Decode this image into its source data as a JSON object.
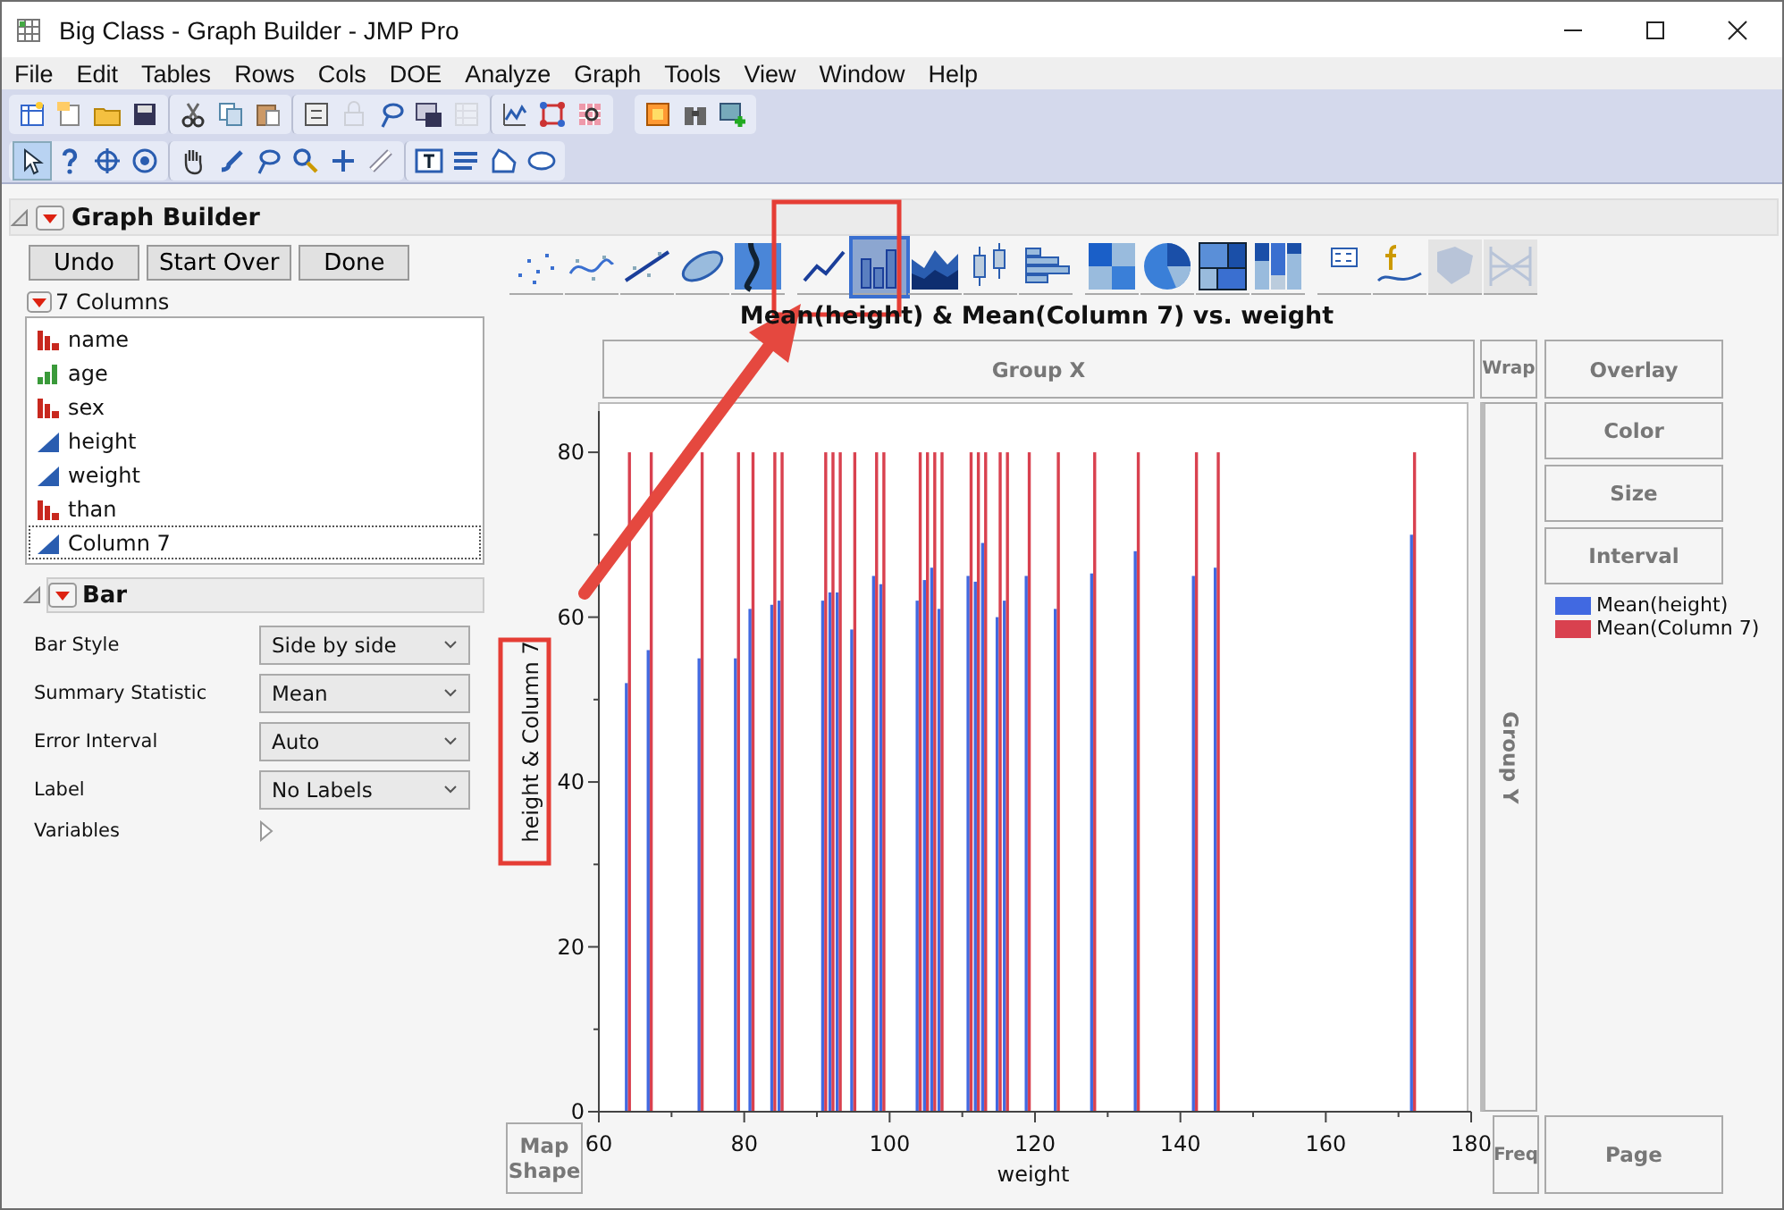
{
  "window": {
    "title": "Big Class - Graph Builder - JMP Pro"
  },
  "menu": [
    "File",
    "Edit",
    "Tables",
    "Rows",
    "Cols",
    "DOE",
    "Analyze",
    "Graph",
    "Tools",
    "View",
    "Window",
    "Help"
  ],
  "toolbars": [
    [
      [
        {
          "kind": "spreadsheet",
          "disabled": false
        },
        {
          "kind": "document",
          "disabled": false
        },
        {
          "kind": "folder",
          "disabled": false
        },
        {
          "kind": "floppy-disk",
          "disabled": false
        }
      ],
      [
        {
          "kind": "scissors",
          "disabled": false
        },
        {
          "kind": "copy",
          "disabled": false
        },
        {
          "kind": "clipboard",
          "disabled": false
        }
      ],
      [
        {
          "kind": "dialog-window",
          "disabled": false
        },
        {
          "kind": "lock",
          "disabled": true
        },
        {
          "kind": "lasso",
          "disabled": false
        },
        {
          "kind": "disk-window",
          "disabled": false
        },
        {
          "kind": "sheet",
          "disabled": true
        }
      ],
      [
        {
          "kind": "line-chart",
          "disabled": false
        },
        {
          "kind": "network",
          "disabled": false
        },
        {
          "kind": "grid-chart",
          "disabled": false
        }
      ],
      [
        {
          "kind": "board",
          "disabled": false
        },
        {
          "kind": "binoculars",
          "disabled": false
        },
        {
          "kind": "plus-window",
          "disabled": false
        }
      ]
    ],
    [
      [
        {
          "kind": "pointer",
          "selected": true
        },
        {
          "kind": "question-mark",
          "selected": false
        },
        {
          "kind": "crosshair",
          "selected": false
        },
        {
          "kind": "target",
          "selected": false
        }
      ],
      [
        {
          "kind": "hand",
          "selected": false
        },
        {
          "kind": "brush",
          "selected": false
        },
        {
          "kind": "lasso",
          "selected": false
        },
        {
          "kind": "magnifier",
          "selected": false
        },
        {
          "kind": "plus",
          "selected": false
        },
        {
          "kind": "ruler",
          "selected": false
        }
      ],
      [
        {
          "kind": "text-box",
          "selected": false
        },
        {
          "kind": "list-lines",
          "selected": false
        },
        {
          "kind": "freeform-shape",
          "selected": false
        },
        {
          "kind": "ellipse",
          "selected": false
        }
      ]
    ]
  ],
  "graph_builder": {
    "title": "Graph Builder",
    "buttons": [
      "Undo",
      "Start Over",
      "Done"
    ],
    "columns_header": "7 Columns",
    "columns": [
      {
        "name": "name",
        "kind": "nominal",
        "selected": false
      },
      {
        "name": "age",
        "kind": "ordinal",
        "selected": false
      },
      {
        "name": "sex",
        "kind": "nominal",
        "selected": false
      },
      {
        "name": "height",
        "kind": "continuous",
        "selected": false
      },
      {
        "name": "weight",
        "kind": "continuous",
        "selected": false
      },
      {
        "name": "than",
        "kind": "nominal",
        "selected": false
      },
      {
        "name": "Column 7",
        "kind": "continuous",
        "selected": true
      }
    ],
    "bar": {
      "title": "Bar",
      "options": [
        {
          "label": "Bar Style",
          "value": "Side by side"
        },
        {
          "label": "Summary Statistic",
          "value": "Mean"
        },
        {
          "label": "Error Interval",
          "value": "Auto"
        },
        {
          "label": "Label",
          "value": "No Labels"
        }
      ],
      "variables_label": "Variables"
    },
    "chart_type_groups": [
      [
        {
          "kind": "points",
          "selected": false,
          "disabled": false
        },
        {
          "kind": "smoother",
          "selected": false,
          "disabled": false
        },
        {
          "kind": "fit-line",
          "selected": false,
          "disabled": false
        },
        {
          "kind": "ellipse",
          "selected": false,
          "disabled": false
        },
        {
          "kind": "contour",
          "selected": false,
          "disabled": false
        }
      ],
      [
        {
          "kind": "line",
          "selected": false,
          "disabled": false
        },
        {
          "kind": "bar",
          "selected": true,
          "disabled": false
        },
        {
          "kind": "area",
          "selected": false,
          "disabled": false
        },
        {
          "kind": "box-plot",
          "selected": false,
          "disabled": false
        },
        {
          "kind": "histogram",
          "selected": false,
          "disabled": false
        }
      ],
      [
        {
          "kind": "heatmap",
          "selected": false,
          "disabled": false
        },
        {
          "kind": "pie",
          "selected": false,
          "disabled": false
        },
        {
          "kind": "treemap",
          "selected": false,
          "disabled": false
        },
        {
          "kind": "mosaic",
          "selected": false,
          "disabled": false
        }
      ],
      [
        {
          "kind": "caption-box",
          "selected": false,
          "disabled": false
        },
        {
          "kind": "formula",
          "selected": false,
          "disabled": false
        },
        {
          "kind": "map-shape",
          "selected": false,
          "disabled": true
        },
        {
          "kind": "parallel",
          "selected": false,
          "disabled": true
        }
      ]
    ],
    "drop_zones": {
      "group_x": "Group X",
      "wrap": "Wrap",
      "overlay": "Overlay",
      "color_role": "Color",
      "size": "Size",
      "interval": "Interval",
      "group_y": "Group Y",
      "map_shape": "Map Shape",
      "freq": "Freq",
      "page": "Page"
    },
    "chart_data": {
      "type": "bar",
      "title": "Mean(height) & Mean(Column 7) vs. weight",
      "xlabel": "weight",
      "ylabel": "height & Column 7",
      "x": [
        64,
        67,
        74,
        79,
        81,
        84,
        85,
        91,
        92,
        93,
        95,
        98,
        99,
        104,
        105,
        106,
        107,
        111,
        112,
        113,
        115,
        116,
        119,
        123,
        128,
        134,
        142,
        145,
        172
      ],
      "series": [
        {
          "name": "Mean(height)",
          "color": "#4169e1",
          "values": [
            52,
            56,
            55,
            55,
            61,
            61.5,
            62,
            62,
            63,
            63,
            58.5,
            65,
            64,
            62,
            64.5,
            66,
            61,
            65,
            64.3,
            69,
            60,
            62,
            65,
            61,
            65.3,
            68,
            65,
            66,
            70
          ]
        },
        {
          "name": "Mean(Column 7)",
          "color": "#d9414f",
          "values": [
            80,
            80,
            80,
            80,
            80,
            80,
            80,
            80,
            80,
            80,
            80,
            80,
            80,
            80,
            80,
            80,
            80,
            80,
            80,
            80,
            80,
            80,
            80,
            80,
            80,
            80,
            80,
            80,
            80
          ]
        }
      ],
      "xlim": [
        60,
        180
      ],
      "ylim": [
        0,
        85
      ],
      "xticks": [
        60,
        80,
        100,
        120,
        140,
        160,
        180
      ],
      "yticks": [
        0,
        20,
        40,
        60,
        80
      ],
      "orientation": "vertical",
      "stacked": false
    }
  }
}
